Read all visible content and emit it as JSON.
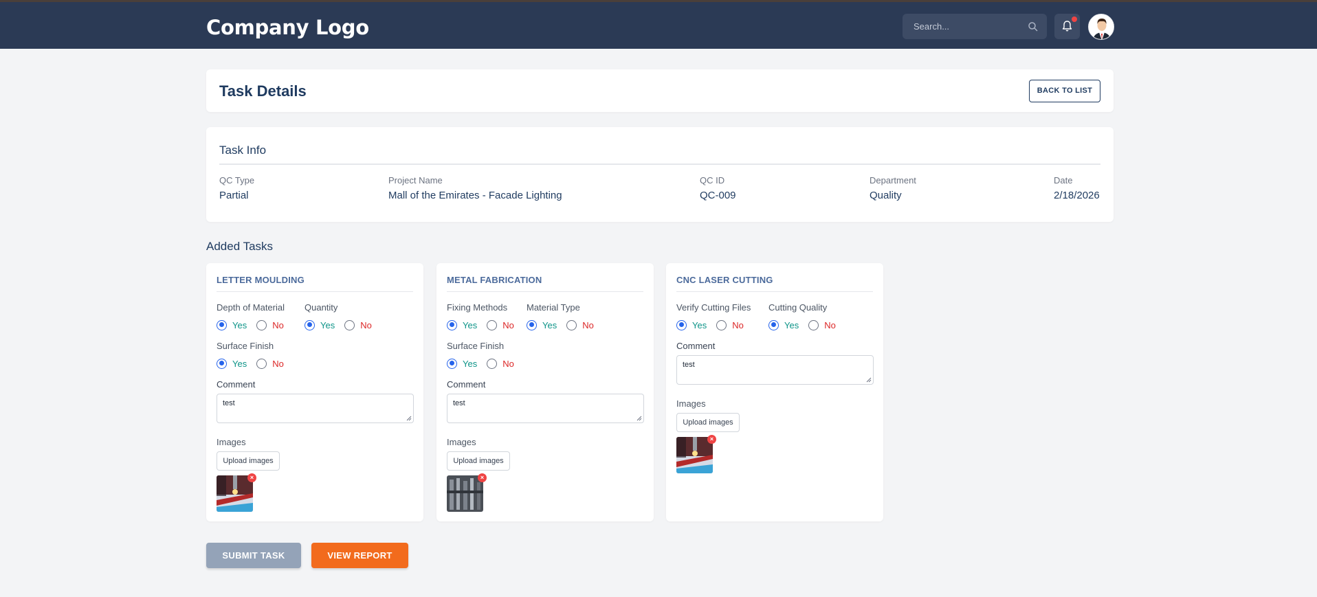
{
  "header": {
    "logo": "Company Logo",
    "search_placeholder": "Search..."
  },
  "page": {
    "title": "Task Details",
    "back_label": "BACK TO LIST"
  },
  "task_info": {
    "title": "Task Info",
    "fields": [
      {
        "label": "QC Type",
        "value": "Partial"
      },
      {
        "label": "Project Name",
        "value": "Mall of the Emirates - Facade Lighting"
      },
      {
        "label": "QC ID",
        "value": "QC-009"
      },
      {
        "label": "Department",
        "value": "Quality"
      },
      {
        "label": "Date",
        "value": "2/18/2026"
      }
    ]
  },
  "added_tasks": {
    "title": "Added Tasks",
    "tasks": [
      {
        "title": "LETTER MOULDING",
        "questions": [
          {
            "label": "Depth of Material",
            "selected": "Yes"
          },
          {
            "label": "Quantity",
            "selected": "Yes"
          },
          {
            "label": "Surface Finish",
            "selected": "Yes"
          }
        ],
        "comment_label": "Comment",
        "comment": "test",
        "images_label": "Images",
        "upload_label": "Upload images",
        "image_count": 1
      },
      {
        "title": "METAL FABRICATION",
        "questions": [
          {
            "label": "Fixing Methods",
            "selected": "Yes"
          },
          {
            "label": "Material Type",
            "selected": "Yes"
          },
          {
            "label": "Surface Finish",
            "selected": "Yes"
          }
        ],
        "comment_label": "Comment",
        "comment": "test",
        "images_label": "Images",
        "upload_label": "Upload images",
        "image_count": 1
      },
      {
        "title": "CNC LASER CUTTING",
        "questions": [
          {
            "label": "Verify Cutting Files",
            "selected": "Yes"
          },
          {
            "label": "Cutting Quality",
            "selected": "Yes"
          }
        ],
        "comment_label": "Comment",
        "comment": "test",
        "images_label": "Images",
        "upload_label": "Upload images",
        "image_count": 1
      }
    ],
    "yes_label": "Yes",
    "no_label": "No",
    "remove_symbol": "×"
  },
  "actions": {
    "submit_label": "SUBMIT TASK",
    "report_label": "VIEW REPORT"
  },
  "colors": {
    "topbar": "#2b3a55",
    "accent_orange": "#f26b1d",
    "yes": "#0d9488",
    "no": "#dc2626",
    "radio": "#2563eb"
  }
}
